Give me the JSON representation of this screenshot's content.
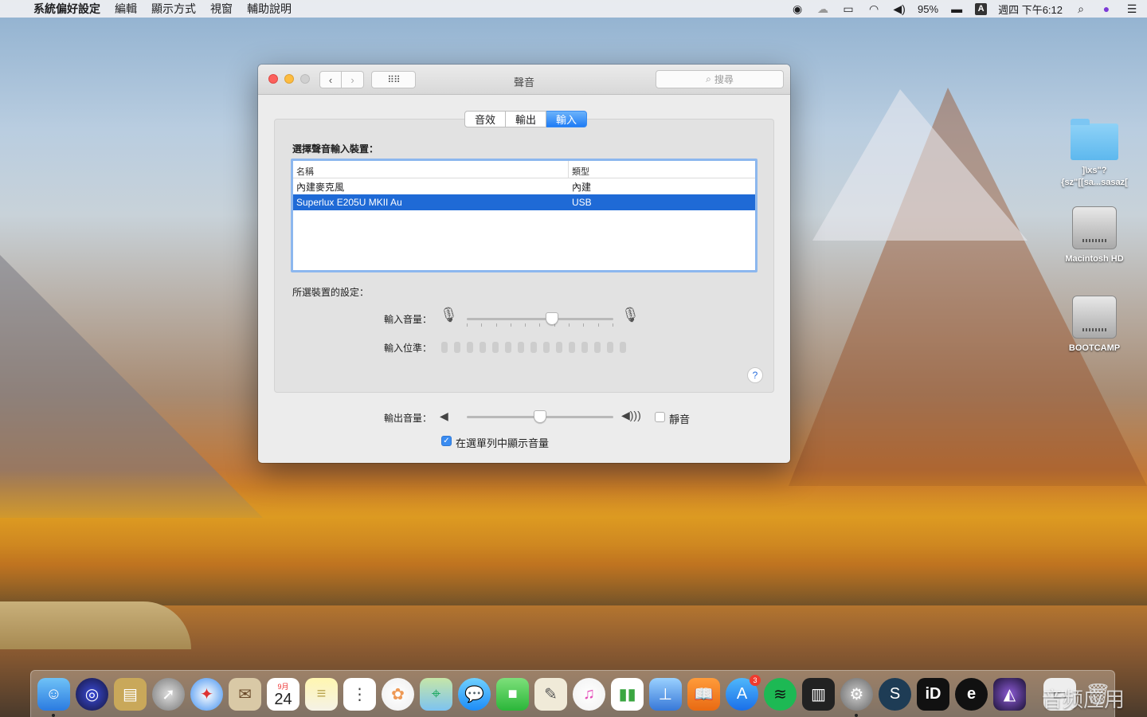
{
  "menubar": {
    "app_name": "系統偏好設定",
    "items": [
      "編輯",
      "顯示方式",
      "視窗",
      "輔助說明"
    ],
    "battery": "95%",
    "input_method": "A",
    "clock": "週四 下午6:12"
  },
  "window": {
    "title": "聲音",
    "search_placeholder": "搜尋",
    "tabs": [
      {
        "label": "音效",
        "active": false
      },
      {
        "label": "輸出",
        "active": false
      },
      {
        "label": "輸入",
        "active": true
      }
    ],
    "device_section_label": "選擇聲音輸入裝置：",
    "table": {
      "headers": [
        "名稱",
        "類型"
      ],
      "rows": [
        {
          "name": "內建麥克風",
          "type": "內建",
          "selected": false
        },
        {
          "name": "Superlux E205U MKII  Au",
          "type": "USB",
          "selected": true
        }
      ]
    },
    "settings_label": "所選裝置的設定：",
    "input_volume_label": "輸入音量：",
    "input_volume_value": 0.58,
    "input_level_label": "輸入位準：",
    "output_volume_label": "輸出音量：",
    "output_volume_value": 0.5,
    "mute_label": "靜音",
    "mute_checked": false,
    "show_in_menu_label": "在選單列中顯示音量",
    "show_in_menu_checked": true,
    "help": "?"
  },
  "desktop": {
    "icons": [
      {
        "label": "]\\xs\"?\n{sz\"[[sa...sasaz[",
        "kind": "folder"
      },
      {
        "label": "Macintosh HD",
        "kind": "drive"
      },
      {
        "label": "BOOTCAMP",
        "kind": "drive"
      }
    ]
  },
  "dock": {
    "calendar_month": "9月",
    "calendar_day": "24",
    "appstore_badge": "3"
  },
  "watermark": "音频应用"
}
